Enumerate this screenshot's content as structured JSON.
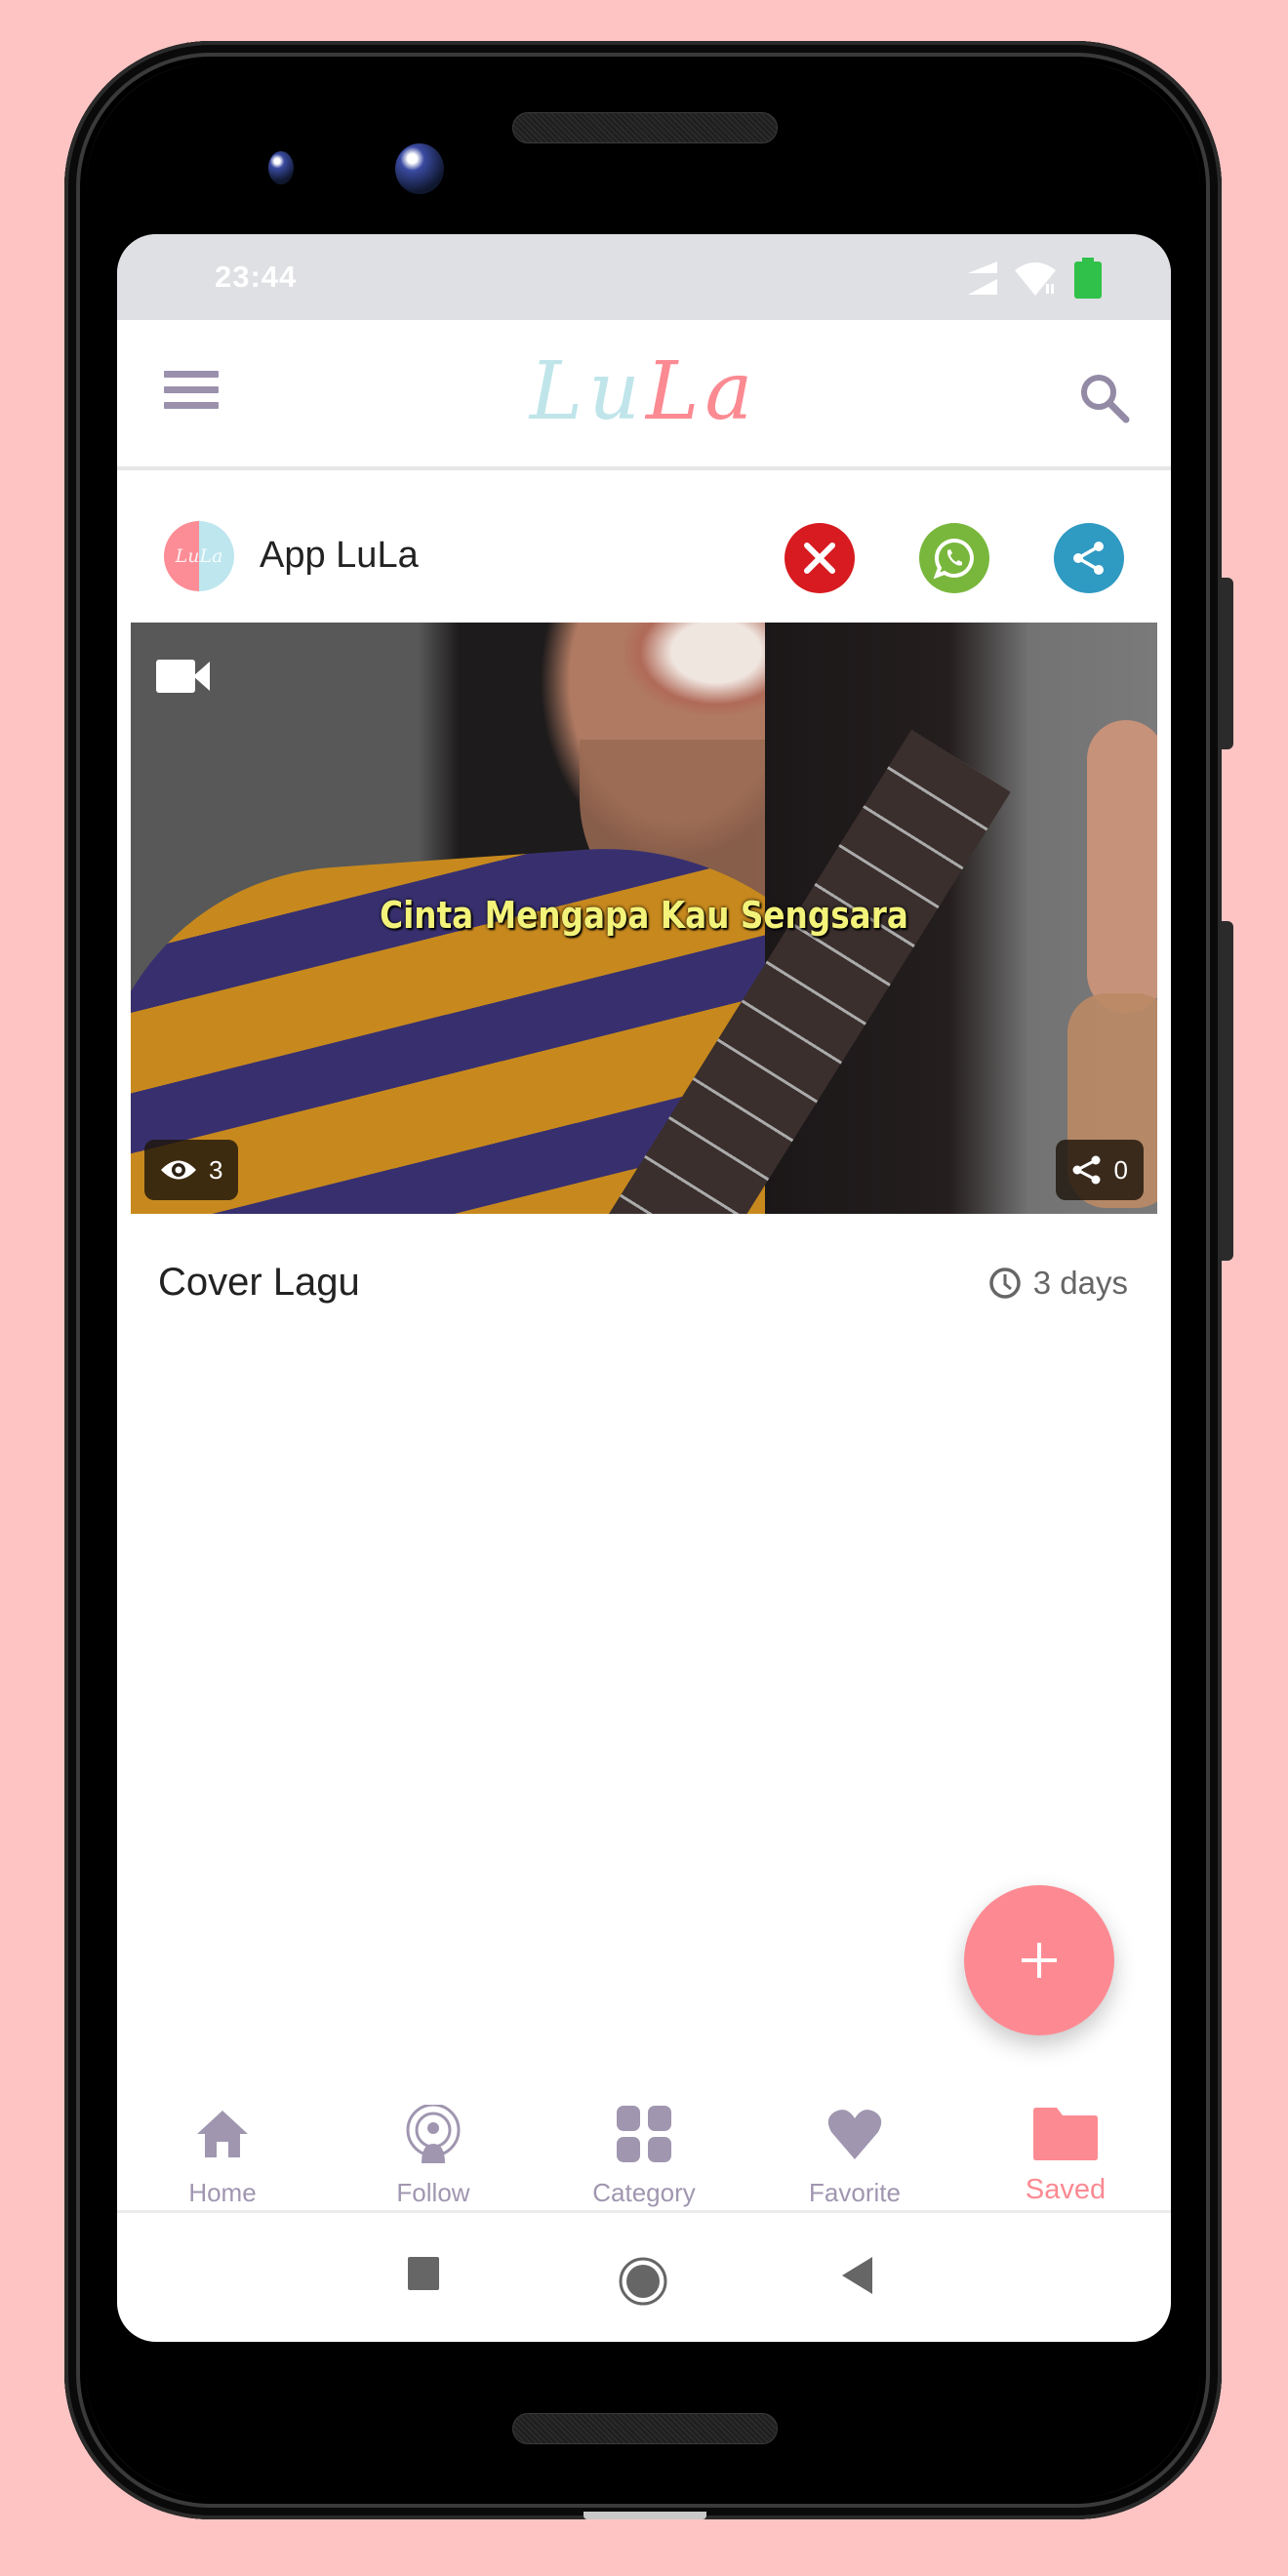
{
  "status_bar": {
    "time": "23:44",
    "icons": [
      "signal-icon",
      "wifi-icon",
      "battery-icon"
    ],
    "battery_color": "#2fc14a"
  },
  "app_bar": {
    "logo_part1": "Lu",
    "logo_part2": "La",
    "logo_colors": {
      "part1": "#bfe5ea",
      "part2": "#fb8a92"
    },
    "menu_icon": "hamburger-menu-icon",
    "search_icon": "search-icon"
  },
  "post": {
    "author_avatar_text": "LuLa",
    "author_name": "App LuLa",
    "actions": [
      {
        "name": "close",
        "icon": "close-icon",
        "color": "#d71b20"
      },
      {
        "name": "whatsapp",
        "icon": "whatsapp-icon",
        "color": "#79b73c"
      },
      {
        "name": "share",
        "icon": "share-icon",
        "color": "#2f9ac2"
      }
    ],
    "media_type_icon": "video-camera-icon",
    "thumbnail_caption": "Cinta Mengapa Kau Sengsara",
    "views": "3",
    "shares": "0",
    "title": "Cover Lagu",
    "time_ago": "3 days"
  },
  "fab": {
    "icon": "plus-icon",
    "color": "#fd8a92"
  },
  "bottom_nav": {
    "items": [
      {
        "label": "Home",
        "icon": "home-icon",
        "active": false
      },
      {
        "label": "Follow",
        "icon": "podcast-follow-icon",
        "active": false
      },
      {
        "label": "Category",
        "icon": "grid-category-icon",
        "active": false
      },
      {
        "label": "Favorite",
        "icon": "heart-icon",
        "active": false
      },
      {
        "label": "Saved",
        "icon": "folder-icon",
        "active": true
      }
    ],
    "inactive_color": "#a096b0",
    "active_color": "#fb8a92"
  },
  "system_nav": [
    "recents-button",
    "home-button",
    "back-button"
  ]
}
